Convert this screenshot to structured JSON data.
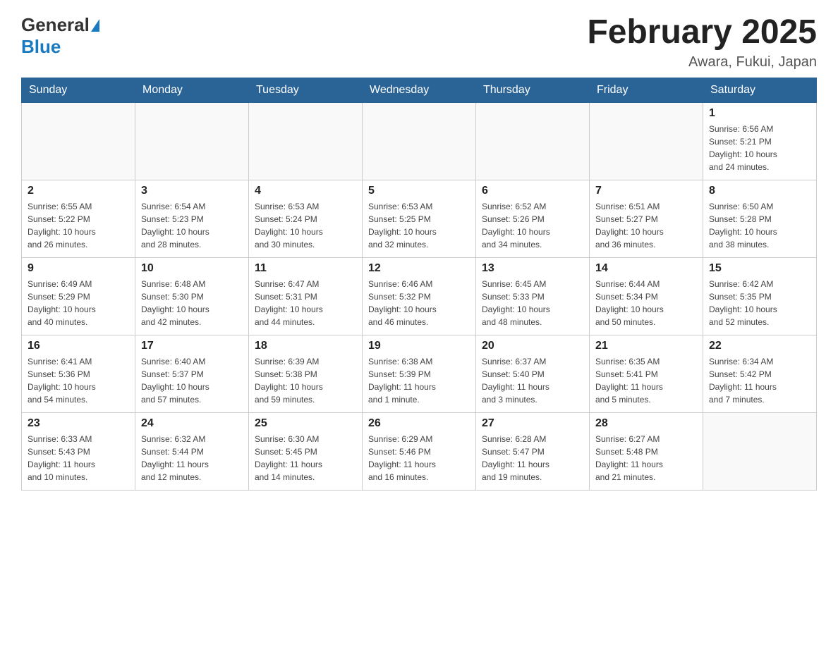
{
  "header": {
    "logo": {
      "general": "General",
      "blue": "Blue"
    },
    "title": "February 2025",
    "location": "Awara, Fukui, Japan"
  },
  "weekdays": [
    "Sunday",
    "Monday",
    "Tuesday",
    "Wednesday",
    "Thursday",
    "Friday",
    "Saturday"
  ],
  "weeks": [
    [
      {
        "day": "",
        "info": ""
      },
      {
        "day": "",
        "info": ""
      },
      {
        "day": "",
        "info": ""
      },
      {
        "day": "",
        "info": ""
      },
      {
        "day": "",
        "info": ""
      },
      {
        "day": "",
        "info": ""
      },
      {
        "day": "1",
        "info": "Sunrise: 6:56 AM\nSunset: 5:21 PM\nDaylight: 10 hours\nand 24 minutes."
      }
    ],
    [
      {
        "day": "2",
        "info": "Sunrise: 6:55 AM\nSunset: 5:22 PM\nDaylight: 10 hours\nand 26 minutes."
      },
      {
        "day": "3",
        "info": "Sunrise: 6:54 AM\nSunset: 5:23 PM\nDaylight: 10 hours\nand 28 minutes."
      },
      {
        "day": "4",
        "info": "Sunrise: 6:53 AM\nSunset: 5:24 PM\nDaylight: 10 hours\nand 30 minutes."
      },
      {
        "day": "5",
        "info": "Sunrise: 6:53 AM\nSunset: 5:25 PM\nDaylight: 10 hours\nand 32 minutes."
      },
      {
        "day": "6",
        "info": "Sunrise: 6:52 AM\nSunset: 5:26 PM\nDaylight: 10 hours\nand 34 minutes."
      },
      {
        "day": "7",
        "info": "Sunrise: 6:51 AM\nSunset: 5:27 PM\nDaylight: 10 hours\nand 36 minutes."
      },
      {
        "day": "8",
        "info": "Sunrise: 6:50 AM\nSunset: 5:28 PM\nDaylight: 10 hours\nand 38 minutes."
      }
    ],
    [
      {
        "day": "9",
        "info": "Sunrise: 6:49 AM\nSunset: 5:29 PM\nDaylight: 10 hours\nand 40 minutes."
      },
      {
        "day": "10",
        "info": "Sunrise: 6:48 AM\nSunset: 5:30 PM\nDaylight: 10 hours\nand 42 minutes."
      },
      {
        "day": "11",
        "info": "Sunrise: 6:47 AM\nSunset: 5:31 PM\nDaylight: 10 hours\nand 44 minutes."
      },
      {
        "day": "12",
        "info": "Sunrise: 6:46 AM\nSunset: 5:32 PM\nDaylight: 10 hours\nand 46 minutes."
      },
      {
        "day": "13",
        "info": "Sunrise: 6:45 AM\nSunset: 5:33 PM\nDaylight: 10 hours\nand 48 minutes."
      },
      {
        "day": "14",
        "info": "Sunrise: 6:44 AM\nSunset: 5:34 PM\nDaylight: 10 hours\nand 50 minutes."
      },
      {
        "day": "15",
        "info": "Sunrise: 6:42 AM\nSunset: 5:35 PM\nDaylight: 10 hours\nand 52 minutes."
      }
    ],
    [
      {
        "day": "16",
        "info": "Sunrise: 6:41 AM\nSunset: 5:36 PM\nDaylight: 10 hours\nand 54 minutes."
      },
      {
        "day": "17",
        "info": "Sunrise: 6:40 AM\nSunset: 5:37 PM\nDaylight: 10 hours\nand 57 minutes."
      },
      {
        "day": "18",
        "info": "Sunrise: 6:39 AM\nSunset: 5:38 PM\nDaylight: 10 hours\nand 59 minutes."
      },
      {
        "day": "19",
        "info": "Sunrise: 6:38 AM\nSunset: 5:39 PM\nDaylight: 11 hours\nand 1 minute."
      },
      {
        "day": "20",
        "info": "Sunrise: 6:37 AM\nSunset: 5:40 PM\nDaylight: 11 hours\nand 3 minutes."
      },
      {
        "day": "21",
        "info": "Sunrise: 6:35 AM\nSunset: 5:41 PM\nDaylight: 11 hours\nand 5 minutes."
      },
      {
        "day": "22",
        "info": "Sunrise: 6:34 AM\nSunset: 5:42 PM\nDaylight: 11 hours\nand 7 minutes."
      }
    ],
    [
      {
        "day": "23",
        "info": "Sunrise: 6:33 AM\nSunset: 5:43 PM\nDaylight: 11 hours\nand 10 minutes."
      },
      {
        "day": "24",
        "info": "Sunrise: 6:32 AM\nSunset: 5:44 PM\nDaylight: 11 hours\nand 12 minutes."
      },
      {
        "day": "25",
        "info": "Sunrise: 6:30 AM\nSunset: 5:45 PM\nDaylight: 11 hours\nand 14 minutes."
      },
      {
        "day": "26",
        "info": "Sunrise: 6:29 AM\nSunset: 5:46 PM\nDaylight: 11 hours\nand 16 minutes."
      },
      {
        "day": "27",
        "info": "Sunrise: 6:28 AM\nSunset: 5:47 PM\nDaylight: 11 hours\nand 19 minutes."
      },
      {
        "day": "28",
        "info": "Sunrise: 6:27 AM\nSunset: 5:48 PM\nDaylight: 11 hours\nand 21 minutes."
      },
      {
        "day": "",
        "info": ""
      }
    ]
  ]
}
